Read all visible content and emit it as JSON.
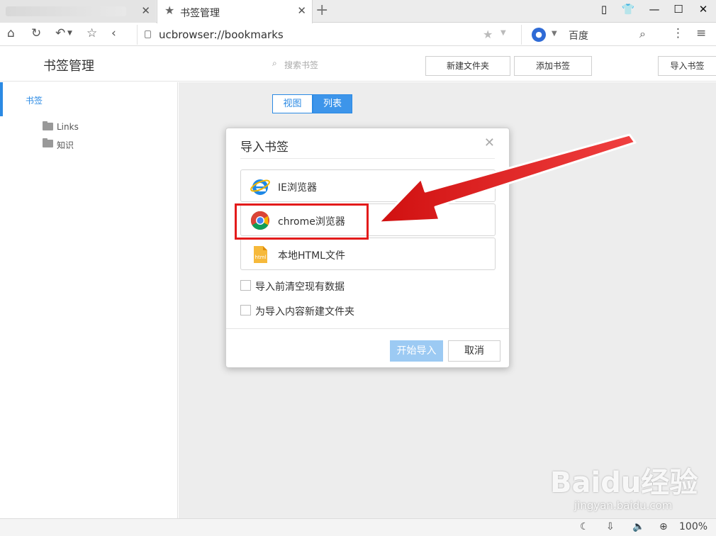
{
  "browser": {
    "active_tab_title": "书签管理",
    "url": "ucbrowser://bookmarks",
    "search_engine": "百度",
    "window_controls": [
      "restore-icon",
      "skin-icon",
      "minimize-icon",
      "maximize-icon",
      "close-icon"
    ]
  },
  "page": {
    "title": "书签管理",
    "search_placeholder": "搜索书签",
    "buttons": {
      "new_folder": "新建文件夹",
      "add_bookmark": "添加书签",
      "import_bookmark": "导入书签"
    }
  },
  "sidebar": {
    "root_label": "书签",
    "folders": [
      {
        "label": "Links"
      },
      {
        "label": "知识"
      }
    ]
  },
  "view_toggle": {
    "view_label": "视图",
    "list_label": "列表",
    "selected": "列表"
  },
  "dialog": {
    "title": "导入书签",
    "options": [
      {
        "label": "IE浏览器",
        "icon": "ie-icon"
      },
      {
        "label": "chrome浏览器",
        "icon": "chrome-icon"
      },
      {
        "label": "本地HTML文件",
        "icon": "html-file-icon"
      }
    ],
    "checkboxes": [
      {
        "label": "导入前清空现有数据",
        "checked": false
      },
      {
        "label": "为导入内容新建文件夹",
        "checked": false
      }
    ],
    "start_button": "开始导入",
    "cancel_button": "取消",
    "highlighted_option": "chrome浏览器"
  },
  "statusbar": {
    "zoom": "100%"
  },
  "watermark": {
    "brand": "Baidu经验",
    "url": "jingyan.baidu.com"
  },
  "colors": {
    "accent": "#2b8ae4",
    "annotation_red": "#e31b1b",
    "start_button": "#9ccaf3"
  }
}
